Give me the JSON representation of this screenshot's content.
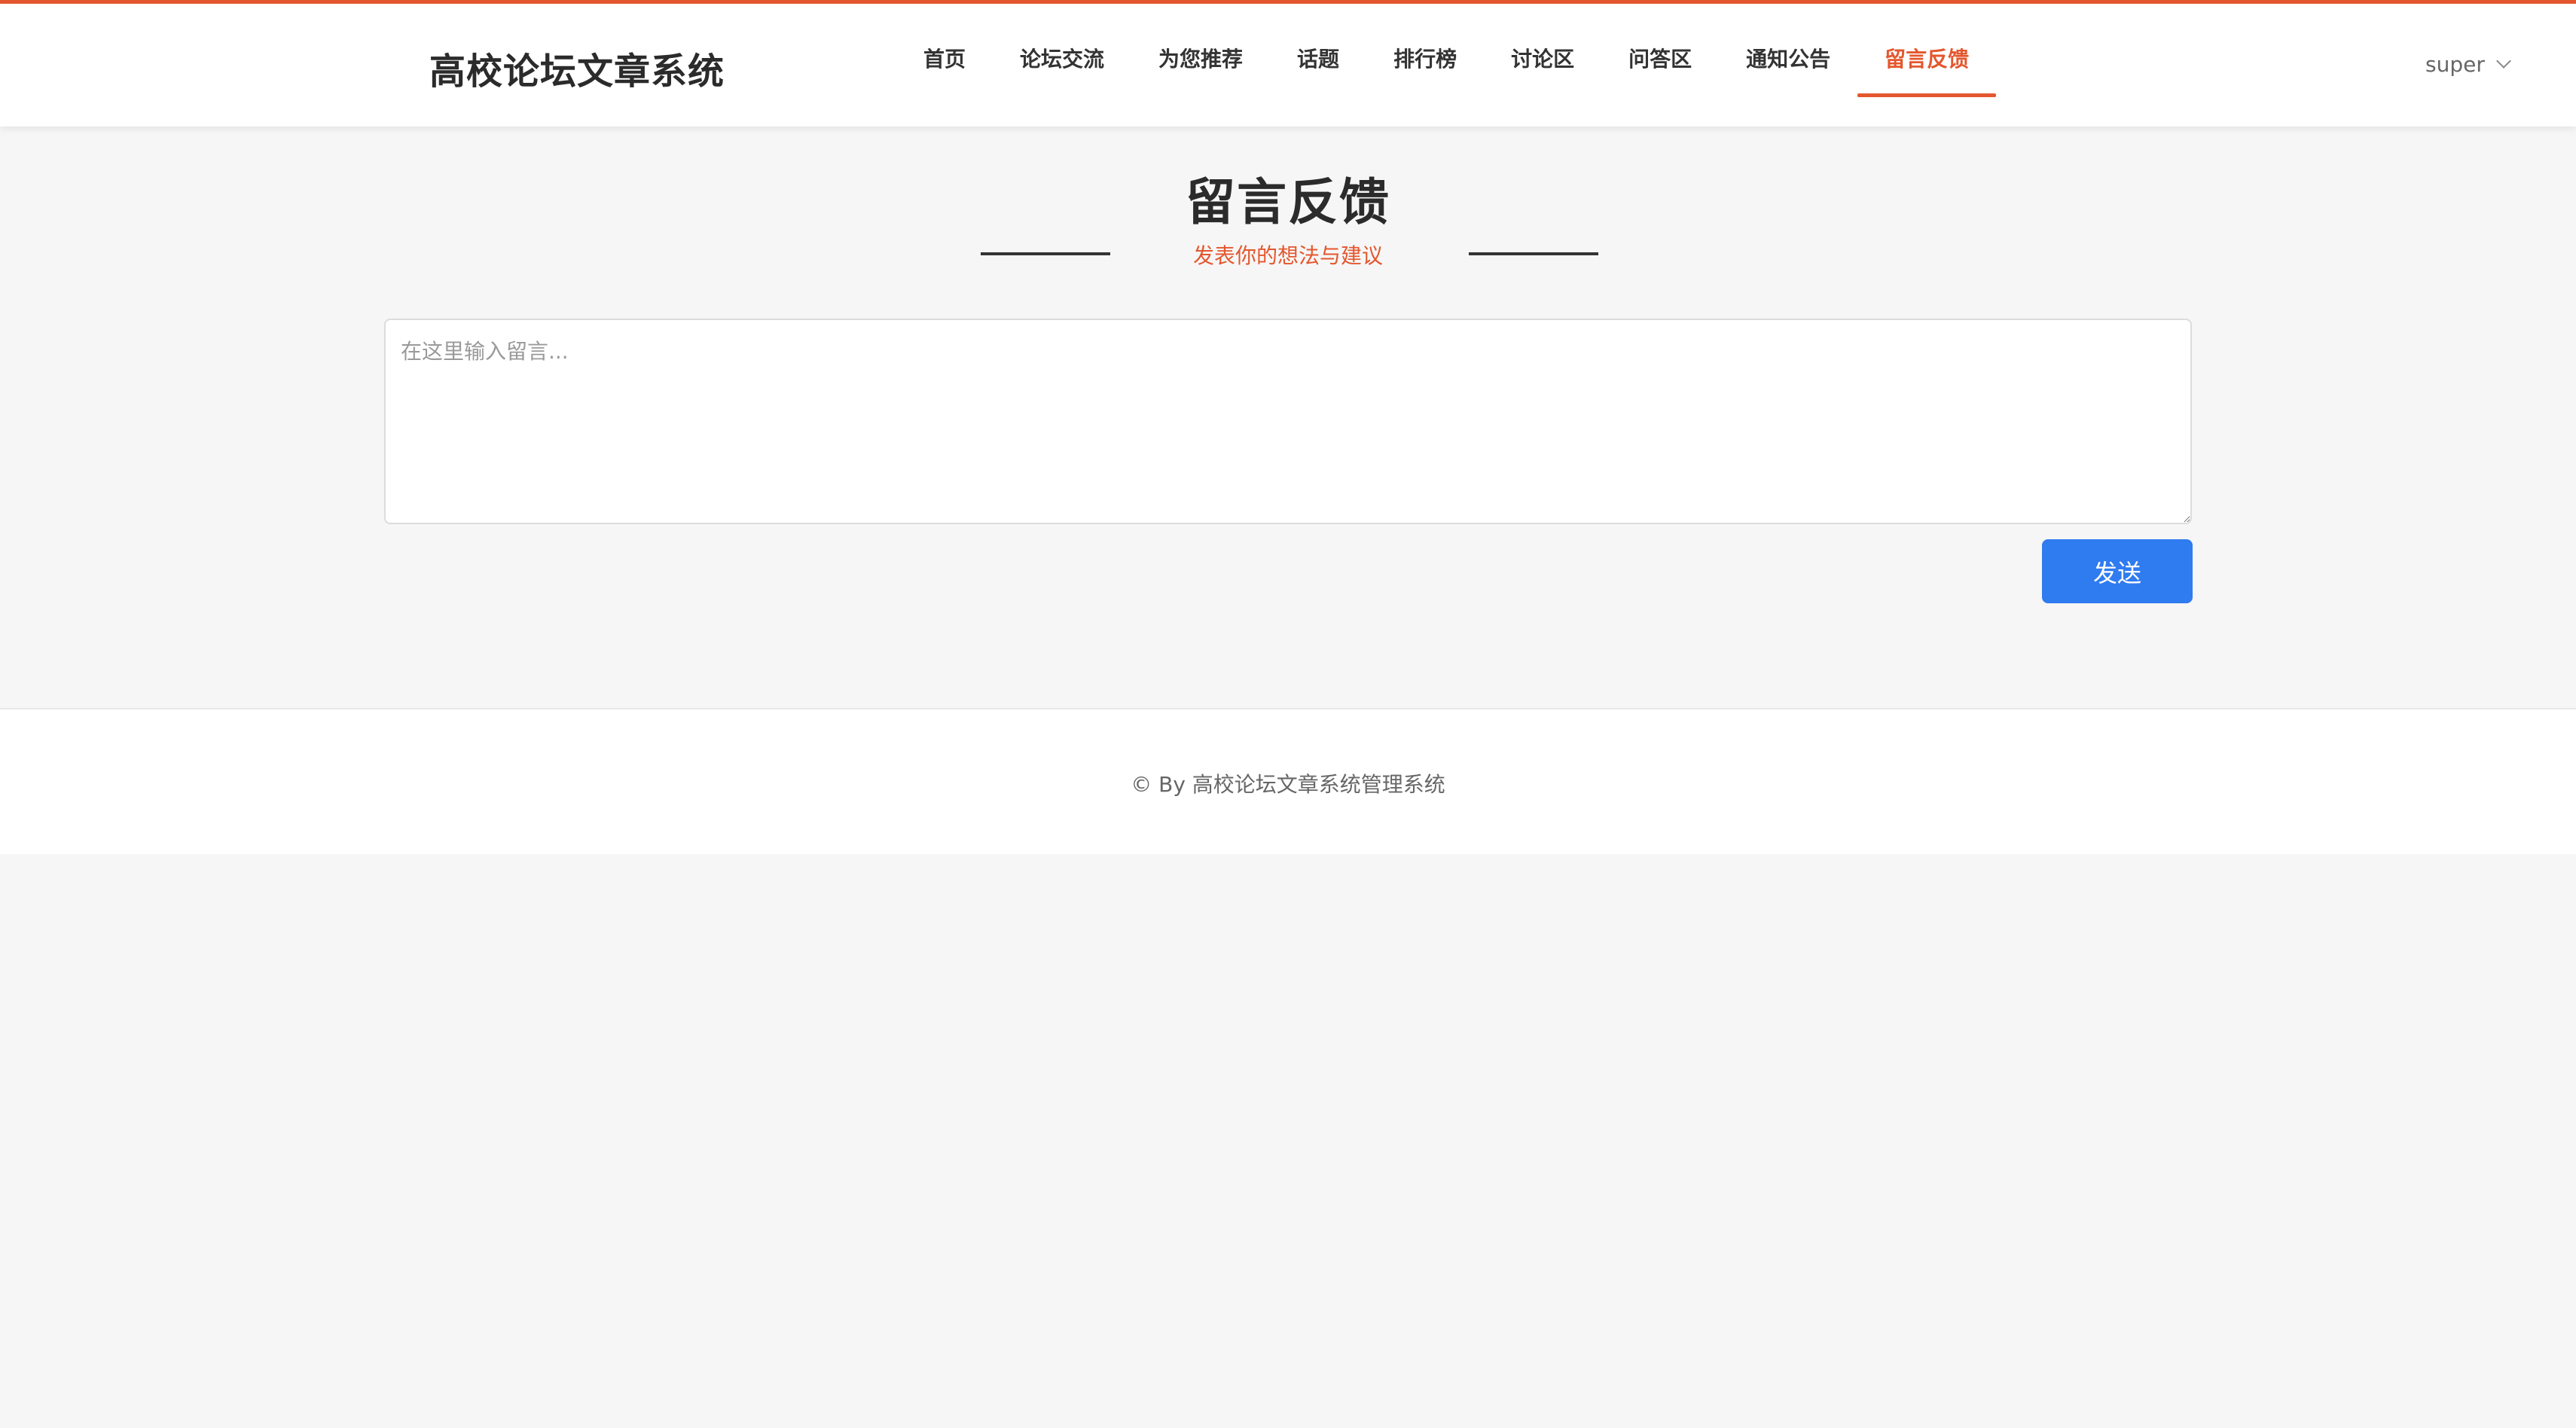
{
  "header": {
    "site_title": "高校论坛文章系统",
    "nav": [
      {
        "label": "首页"
      },
      {
        "label": "论坛交流"
      },
      {
        "label": "为您推荐"
      },
      {
        "label": "话题"
      },
      {
        "label": "排行榜"
      },
      {
        "label": "讨论区"
      },
      {
        "label": "问答区"
      },
      {
        "label": "通知公告"
      },
      {
        "label": "留言反馈",
        "active": true
      }
    ],
    "user": {
      "name": "super",
      "icon": "chevron-down-icon"
    }
  },
  "main": {
    "heading": "留言反馈",
    "subtitle": "发表你的想法与建议",
    "message_input": {
      "placeholder": "在这里输入留言...",
      "value": ""
    },
    "send_label": "发送"
  },
  "footer": {
    "text": "© By 高校论坛文章系统管理系统"
  },
  "colors": {
    "accent": "#e4572e",
    "button": "#2f7bf0",
    "background": "#f6f6f6"
  }
}
